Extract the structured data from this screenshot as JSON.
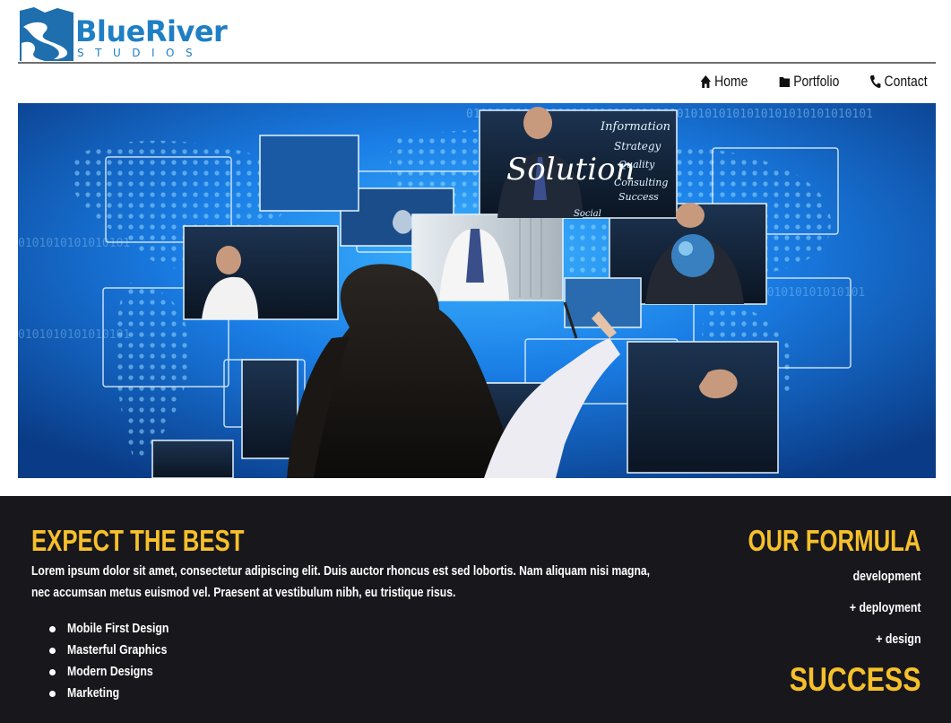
{
  "brand": {
    "name": "BlueRiver",
    "subtitle": "STUDIOS",
    "color": "#1f7fc4"
  },
  "nav": {
    "items": [
      {
        "label": "Home",
        "icon": "home-icon"
      },
      {
        "label": "Portfolio",
        "icon": "folder-icon"
      },
      {
        "label": "Contact",
        "icon": "phone-icon"
      }
    ]
  },
  "hero": {
    "image": "businesswoman-touching-digital-screens-world-map",
    "screen_words": [
      "Solution",
      "Information",
      "Strategy",
      "Quality",
      "Consulting",
      "Success",
      "Social"
    ]
  },
  "expect": {
    "heading": "EXPECT THE BEST",
    "paragraph": "Lorem ipsum dolor sit amet, consectetur adipiscing elit. Duis auctor rhoncus est sed lobortis. Nam aliquam nisi magna, nec accumsan metus euismod vel. Praesent at vestibulum nibh, eu tristique risus.",
    "list": [
      "Mobile First Design",
      "Masterful Graphics",
      "Modern Designs",
      "Marketing"
    ]
  },
  "formula": {
    "heading": "OUR FORMULA",
    "items": [
      "development",
      "+ deployment",
      "+ design"
    ],
    "result": "SUCCESS"
  },
  "colors": {
    "accent": "#f6c02b",
    "dark_bg": "#18171c",
    "hero_blue": "#0c4a9e"
  }
}
